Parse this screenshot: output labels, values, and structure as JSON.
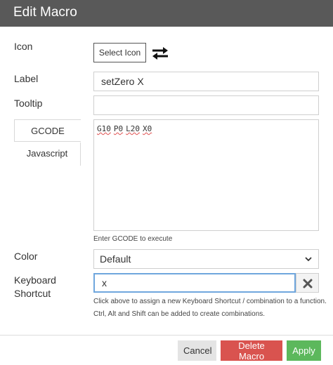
{
  "dialog": {
    "title": "Edit Macro"
  },
  "icon_row": {
    "label": "Icon",
    "select_button": "Select Icon",
    "icon": "swap-arrows-icon"
  },
  "label_row": {
    "label": "Label",
    "value": "setZero X"
  },
  "tooltip_row": {
    "label": "Tooltip",
    "value": ""
  },
  "tabs": [
    {
      "label": "GCODE",
      "active": true
    },
    {
      "label": "Javascript",
      "active": false
    }
  ],
  "code": {
    "tokens": [
      "G10",
      "P0",
      "L20",
      "X0"
    ],
    "help": "Enter GCODE to execute"
  },
  "color_row": {
    "label": "Color",
    "selected": "Default"
  },
  "shortcut_row": {
    "label_line1": "Keyboard",
    "label_line2": "Shortcut",
    "value": "x",
    "help_line1": "Click above to assign a new Keyboard Shortcut / combination to a function.",
    "help_line2": "Ctrl, Alt and Shift can be added to create combinations."
  },
  "footer": {
    "cancel": "Cancel",
    "delete": "Delete Macro",
    "apply": "Apply"
  },
  "colors": {
    "titlebar": "#595959",
    "delete": "#d9534f",
    "apply": "#5cb85c",
    "focus": "#6fa6dd"
  }
}
